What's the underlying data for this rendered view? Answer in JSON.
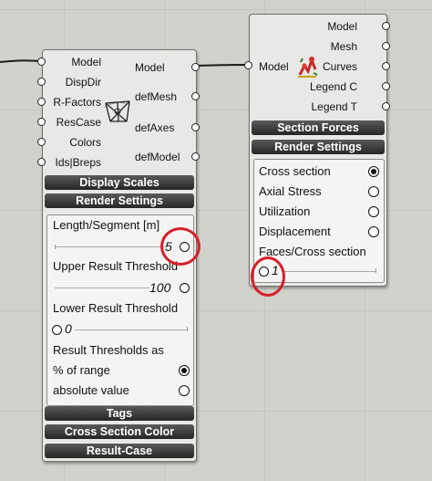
{
  "left_component": {
    "inputs": [
      "Model",
      "DispDir",
      "R-Factors",
      "ResCase",
      "Colors",
      "Ids|Breps"
    ],
    "outputs": [
      "Model",
      "defMesh",
      "defAxes",
      "defModel"
    ],
    "bars": {
      "display_scales": "Display Scales",
      "render_settings": "Render Settings",
      "tags": "Tags",
      "cross_section_color": "Cross Section Color",
      "result_case": "Result-Case"
    },
    "panel": {
      "length_segment_label": "Length/Segment [m]",
      "length_segment_value": "5",
      "upper_threshold_label": "Upper Result Threshold",
      "upper_threshold_value": "100",
      "lower_threshold_label": "Lower Result Threshold",
      "lower_threshold_value": "0",
      "thresholds_as_label": "Result Thresholds as",
      "options": [
        {
          "label": "% of range",
          "selected": true
        },
        {
          "label": "absolute value",
          "selected": false
        }
      ]
    }
  },
  "right_component": {
    "input": "Model",
    "outputs": [
      "Model",
      "Mesh",
      "Curves",
      "Legend C",
      "Legend T"
    ],
    "bars": {
      "section_forces": "Section Forces",
      "render_settings": "Render Settings"
    },
    "panel": {
      "options": [
        {
          "label": "Cross section",
          "selected": true
        },
        {
          "label": "Axial Stress",
          "selected": false
        },
        {
          "label": "Utilization",
          "selected": false
        },
        {
          "label": "Displacement",
          "selected": false
        }
      ],
      "faces_label": "Faces/Cross section",
      "faces_value": "1"
    }
  },
  "colors": {
    "canvas": "#d2d2cd",
    "component": "#e8e8e6",
    "bar_dark": "#3a3a3a",
    "annotation_red": "#d81f2a"
  },
  "icons": {
    "left": "deformation-icon",
    "right": "beam-view-icon"
  }
}
